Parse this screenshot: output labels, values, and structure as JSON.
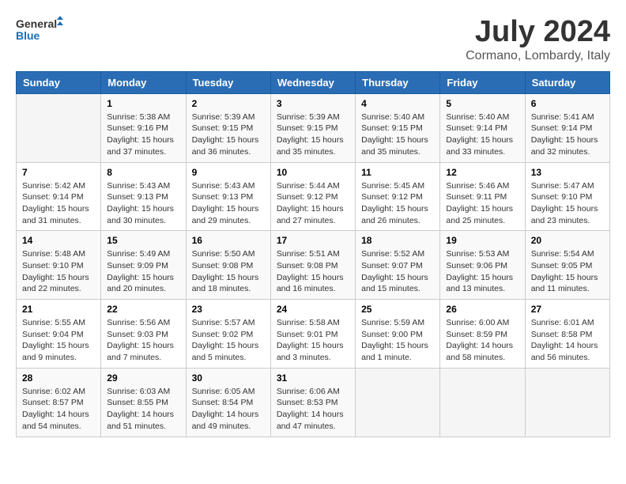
{
  "header": {
    "logo_line1": "General",
    "logo_line2": "Blue",
    "month_year": "July 2024",
    "location": "Cormano, Lombardy, Italy"
  },
  "days_of_week": [
    "Sunday",
    "Monday",
    "Tuesday",
    "Wednesday",
    "Thursday",
    "Friday",
    "Saturday"
  ],
  "weeks": [
    [
      {
        "day": "",
        "info": ""
      },
      {
        "day": "1",
        "info": "Sunrise: 5:38 AM\nSunset: 9:16 PM\nDaylight: 15 hours\nand 37 minutes."
      },
      {
        "day": "2",
        "info": "Sunrise: 5:39 AM\nSunset: 9:15 PM\nDaylight: 15 hours\nand 36 minutes."
      },
      {
        "day": "3",
        "info": "Sunrise: 5:39 AM\nSunset: 9:15 PM\nDaylight: 15 hours\nand 35 minutes."
      },
      {
        "day": "4",
        "info": "Sunrise: 5:40 AM\nSunset: 9:15 PM\nDaylight: 15 hours\nand 35 minutes."
      },
      {
        "day": "5",
        "info": "Sunrise: 5:40 AM\nSunset: 9:14 PM\nDaylight: 15 hours\nand 33 minutes."
      },
      {
        "day": "6",
        "info": "Sunrise: 5:41 AM\nSunset: 9:14 PM\nDaylight: 15 hours\nand 32 minutes."
      }
    ],
    [
      {
        "day": "7",
        "info": "Sunrise: 5:42 AM\nSunset: 9:14 PM\nDaylight: 15 hours\nand 31 minutes."
      },
      {
        "day": "8",
        "info": "Sunrise: 5:43 AM\nSunset: 9:13 PM\nDaylight: 15 hours\nand 30 minutes."
      },
      {
        "day": "9",
        "info": "Sunrise: 5:43 AM\nSunset: 9:13 PM\nDaylight: 15 hours\nand 29 minutes."
      },
      {
        "day": "10",
        "info": "Sunrise: 5:44 AM\nSunset: 9:12 PM\nDaylight: 15 hours\nand 27 minutes."
      },
      {
        "day": "11",
        "info": "Sunrise: 5:45 AM\nSunset: 9:12 PM\nDaylight: 15 hours\nand 26 minutes."
      },
      {
        "day": "12",
        "info": "Sunrise: 5:46 AM\nSunset: 9:11 PM\nDaylight: 15 hours\nand 25 minutes."
      },
      {
        "day": "13",
        "info": "Sunrise: 5:47 AM\nSunset: 9:10 PM\nDaylight: 15 hours\nand 23 minutes."
      }
    ],
    [
      {
        "day": "14",
        "info": "Sunrise: 5:48 AM\nSunset: 9:10 PM\nDaylight: 15 hours\nand 22 minutes."
      },
      {
        "day": "15",
        "info": "Sunrise: 5:49 AM\nSunset: 9:09 PM\nDaylight: 15 hours\nand 20 minutes."
      },
      {
        "day": "16",
        "info": "Sunrise: 5:50 AM\nSunset: 9:08 PM\nDaylight: 15 hours\nand 18 minutes."
      },
      {
        "day": "17",
        "info": "Sunrise: 5:51 AM\nSunset: 9:08 PM\nDaylight: 15 hours\nand 16 minutes."
      },
      {
        "day": "18",
        "info": "Sunrise: 5:52 AM\nSunset: 9:07 PM\nDaylight: 15 hours\nand 15 minutes."
      },
      {
        "day": "19",
        "info": "Sunrise: 5:53 AM\nSunset: 9:06 PM\nDaylight: 15 hours\nand 13 minutes."
      },
      {
        "day": "20",
        "info": "Sunrise: 5:54 AM\nSunset: 9:05 PM\nDaylight: 15 hours\nand 11 minutes."
      }
    ],
    [
      {
        "day": "21",
        "info": "Sunrise: 5:55 AM\nSunset: 9:04 PM\nDaylight: 15 hours\nand 9 minutes."
      },
      {
        "day": "22",
        "info": "Sunrise: 5:56 AM\nSunset: 9:03 PM\nDaylight: 15 hours\nand 7 minutes."
      },
      {
        "day": "23",
        "info": "Sunrise: 5:57 AM\nSunset: 9:02 PM\nDaylight: 15 hours\nand 5 minutes."
      },
      {
        "day": "24",
        "info": "Sunrise: 5:58 AM\nSunset: 9:01 PM\nDaylight: 15 hours\nand 3 minutes."
      },
      {
        "day": "25",
        "info": "Sunrise: 5:59 AM\nSunset: 9:00 PM\nDaylight: 15 hours\nand 1 minute."
      },
      {
        "day": "26",
        "info": "Sunrise: 6:00 AM\nSunset: 8:59 PM\nDaylight: 14 hours\nand 58 minutes."
      },
      {
        "day": "27",
        "info": "Sunrise: 6:01 AM\nSunset: 8:58 PM\nDaylight: 14 hours\nand 56 minutes."
      }
    ],
    [
      {
        "day": "28",
        "info": "Sunrise: 6:02 AM\nSunset: 8:57 PM\nDaylight: 14 hours\nand 54 minutes."
      },
      {
        "day": "29",
        "info": "Sunrise: 6:03 AM\nSunset: 8:55 PM\nDaylight: 14 hours\nand 51 minutes."
      },
      {
        "day": "30",
        "info": "Sunrise: 6:05 AM\nSunset: 8:54 PM\nDaylight: 14 hours\nand 49 minutes."
      },
      {
        "day": "31",
        "info": "Sunrise: 6:06 AM\nSunset: 8:53 PM\nDaylight: 14 hours\nand 47 minutes."
      },
      {
        "day": "",
        "info": ""
      },
      {
        "day": "",
        "info": ""
      },
      {
        "day": "",
        "info": ""
      }
    ]
  ]
}
